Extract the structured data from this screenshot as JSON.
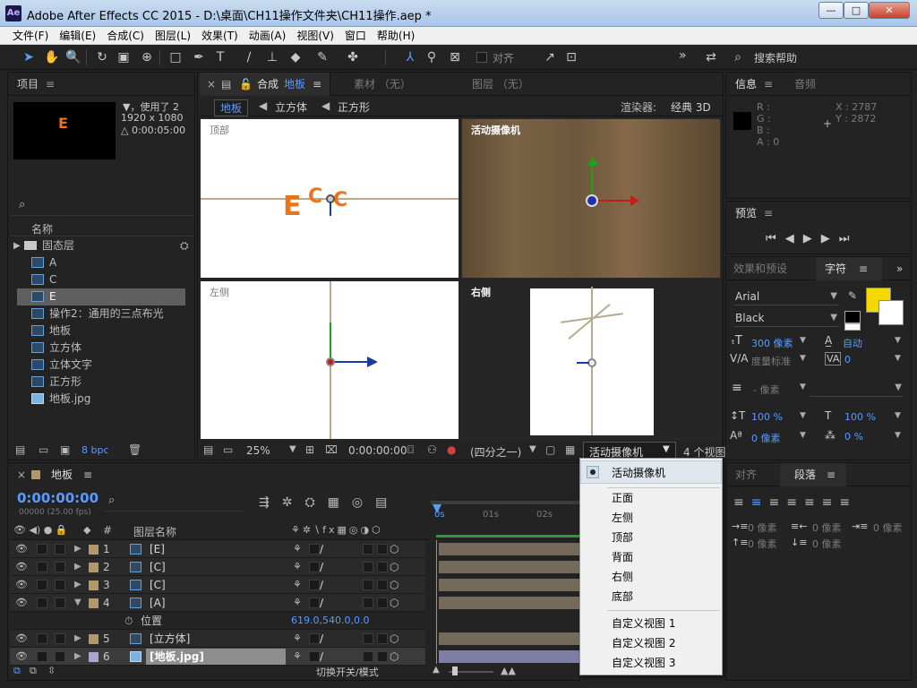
{
  "window": {
    "app_icon": "Ae",
    "title": "Adobe After Effects CC 2015 - D:\\桌面\\CH11操作文件夹\\CH11操作.aep *",
    "min": "—",
    "max": "□",
    "close": "✕"
  },
  "menu": [
    "文件(F)",
    "编辑(E)",
    "合成(C)",
    "图层(L)",
    "效果(T)",
    "动画(A)",
    "视图(V)",
    "窗口",
    "帮助(H)"
  ],
  "toolbar": {
    "align_label": "对齐",
    "search_help": "搜索帮助",
    "more": "»"
  },
  "project": {
    "title": "项目",
    "thumb_letter": "E",
    "info_used": "▼，使用了 2",
    "info_size": "1920 x 1080",
    "info_dur": "△ 0:00:05:00",
    "col_name": "名称",
    "items": [
      "固态层",
      "A",
      "C",
      "E",
      "操作2：通用的三点布光",
      "地板",
      "立方体",
      "立体文字",
      "正方形",
      "地板.jpg"
    ],
    "bpc": "8 bpc"
  },
  "comp": {
    "tab_label": "合成",
    "tab_name": "地板",
    "footage_tab": "素材 （无）",
    "layer_tab": "图层 （无）",
    "crumbs": [
      "地板",
      "立方体",
      "正方形"
    ],
    "renderer_label": "渲染器:",
    "renderer_value": "经典 3D",
    "views": {
      "top": "顶部",
      "active": "活动摄像机",
      "left": "左侧",
      "right": "右侧"
    },
    "zoom": "25%",
    "timecode": "0:00:00:00",
    "resolution": "(四分之一)",
    "camera_select": "活动摄像机",
    "view_count": "4 个视图"
  },
  "dropdown": {
    "selected": "活动摄像机",
    "group1": [
      "正面",
      "左侧",
      "顶部",
      "背面",
      "右侧",
      "底部"
    ],
    "group2": [
      "自定义视图 1",
      "自定义视图 2",
      "自定义视图 3"
    ]
  },
  "timeline": {
    "tab_name": "地板",
    "timecode": "0:00:00:00",
    "fps": "00000 (25.00 fps)",
    "col_hash": "#",
    "col_layer": "图层名称",
    "ruler": [
      "0s",
      "01s",
      "02s"
    ],
    "layers": [
      {
        "num": "1",
        "name": "[E]"
      },
      {
        "num": "2",
        "name": "[C]"
      },
      {
        "num": "3",
        "name": "[C]"
      },
      {
        "num": "4",
        "name": "[A]"
      },
      {
        "num": "5",
        "name": "[立方体]"
      },
      {
        "num": "6",
        "name": "[地板.jpg]"
      }
    ],
    "prop_name": "位置",
    "prop_value": "619.0,540.0,0.0",
    "footer": "切换开关/模式"
  },
  "info": {
    "tab": "信息",
    "audio_tab": "音频",
    "rgba": [
      "R :",
      "G :",
      "B :",
      "A : 0"
    ],
    "x": "X : 2787",
    "y": "Y : 2872"
  },
  "preview": {
    "title": "预览"
  },
  "character": {
    "effects_tab": "效果和预设",
    "tab": "字符",
    "font": "Arial",
    "style": "Black",
    "size": "300 像素",
    "leading": "自动",
    "kerning": "度量标准",
    "tracking": "0",
    "stroke": "- 像素",
    "vscale": "100 %",
    "hscale": "100 %",
    "baseline": "0 像素",
    "tsume": "0 %",
    "fill_color": "#f5d800"
  },
  "paragraph": {
    "align_tab": "对齐",
    "tab": "段落",
    "indent_left": "0 像素",
    "indent_right": "0 像素",
    "indent_first": "0 像素",
    "space_before": "0 像素",
    "space_after": "0 像素"
  }
}
